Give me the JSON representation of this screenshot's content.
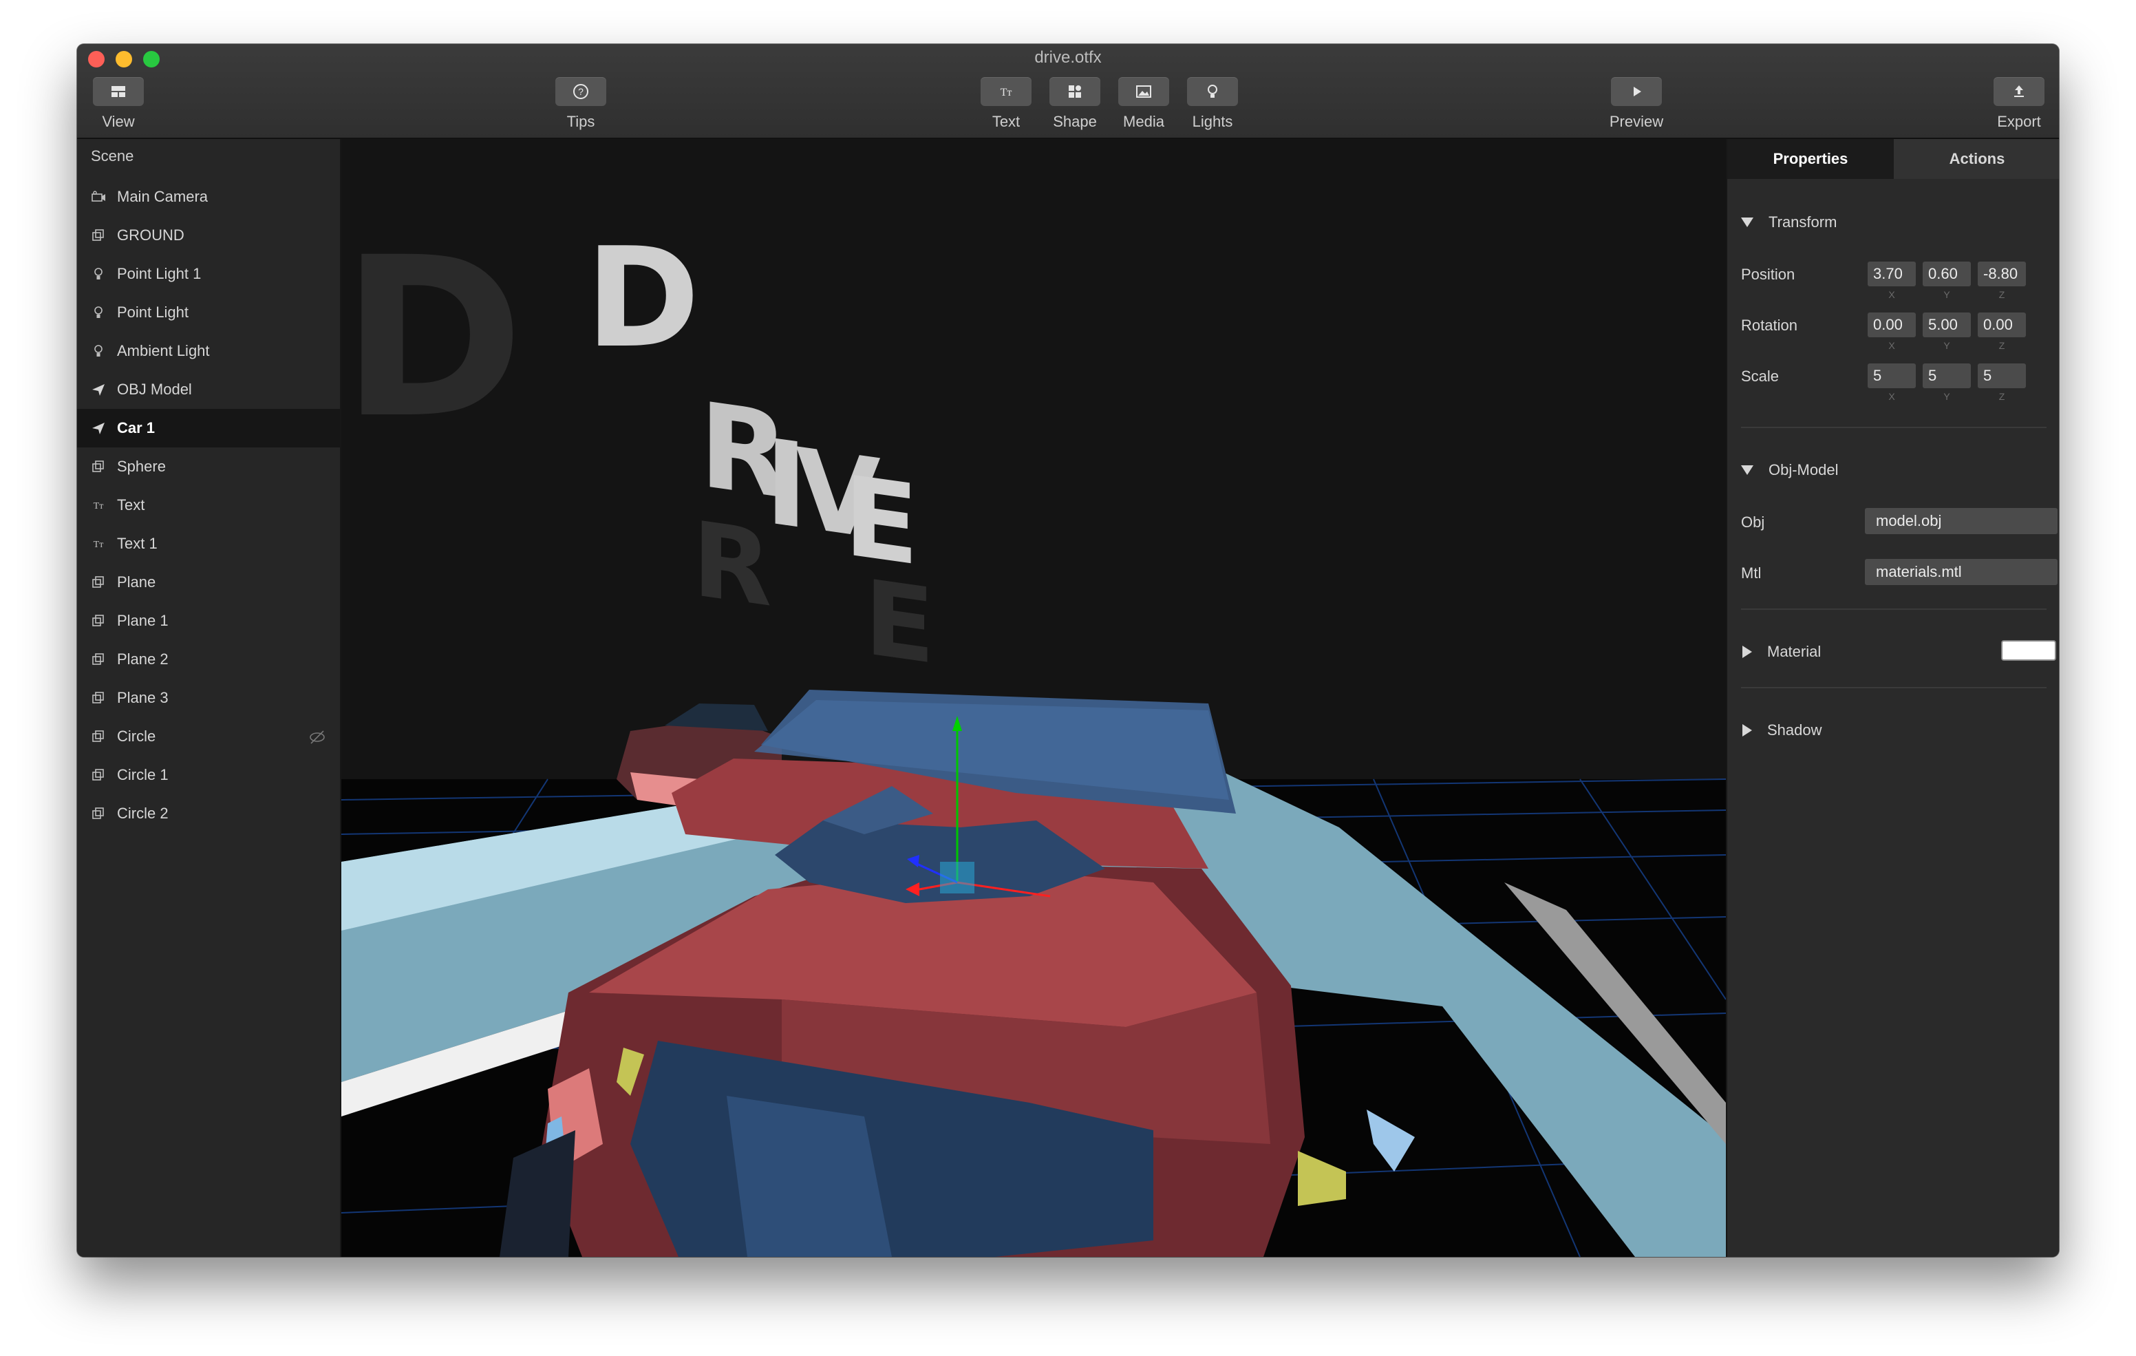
{
  "window": {
    "title": "drive.otfx"
  },
  "toolbar": {
    "view": "View",
    "tips": "Tips",
    "text": "Text",
    "shape": "Shape",
    "media": "Media",
    "lights": "Lights",
    "preview": "Preview",
    "export": "Export"
  },
  "sidebar": {
    "title": "Scene",
    "items": [
      {
        "label": "Main Camera",
        "icon": "camera-icon"
      },
      {
        "label": "GROUND",
        "icon": "shape-icon"
      },
      {
        "label": "Point Light 1",
        "icon": "bulb-icon"
      },
      {
        "label": "Point Light",
        "icon": "bulb-icon"
      },
      {
        "label": "Ambient Light",
        "icon": "bulb-icon"
      },
      {
        "label": "OBJ Model",
        "icon": "model-icon"
      },
      {
        "label": "Car 1",
        "icon": "model-icon",
        "selected": true
      },
      {
        "label": "Sphere",
        "icon": "shape-icon"
      },
      {
        "label": "Text",
        "icon": "text-icon"
      },
      {
        "label": "Text 1",
        "icon": "text-icon"
      },
      {
        "label": "Plane",
        "icon": "shape-icon"
      },
      {
        "label": "Plane 1",
        "icon": "shape-icon"
      },
      {
        "label": "Plane 2",
        "icon": "shape-icon"
      },
      {
        "label": "Plane 3",
        "icon": "shape-icon"
      },
      {
        "label": "Circle",
        "icon": "shape-icon",
        "hidden": true
      },
      {
        "label": "Circle 1",
        "icon": "shape-icon"
      },
      {
        "label": "Circle 2",
        "icon": "shape-icon"
      }
    ]
  },
  "viewport": {
    "scene_text": [
      "D",
      "R",
      "I",
      "V",
      "E"
    ],
    "colors": {
      "car_body": "#a8464a",
      "car_glass": "#3b5b86",
      "road": "#b9dbe8",
      "grid": "#1f5fd0"
    }
  },
  "panel": {
    "tabs": {
      "properties": "Properties",
      "actions": "Actions"
    },
    "transform": {
      "title": "Transform",
      "position_label": "Position",
      "position": [
        "3.70",
        "0.60",
        "-8.80"
      ],
      "rotation_label": "Rotation",
      "rotation": [
        "0.00",
        "5.00",
        "0.00"
      ],
      "scale_label": "Scale",
      "scale": [
        "5",
        "5",
        "5"
      ],
      "axes": [
        "X",
        "Y",
        "Z"
      ]
    },
    "obj_model": {
      "title": "Obj-Model",
      "obj_label": "Obj",
      "obj_value": "model.obj",
      "mtl_label": "Mtl",
      "mtl_value": "materials.mtl"
    },
    "material": {
      "title": "Material",
      "color": "#ffffff"
    },
    "shadow": {
      "title": "Shadow"
    }
  }
}
